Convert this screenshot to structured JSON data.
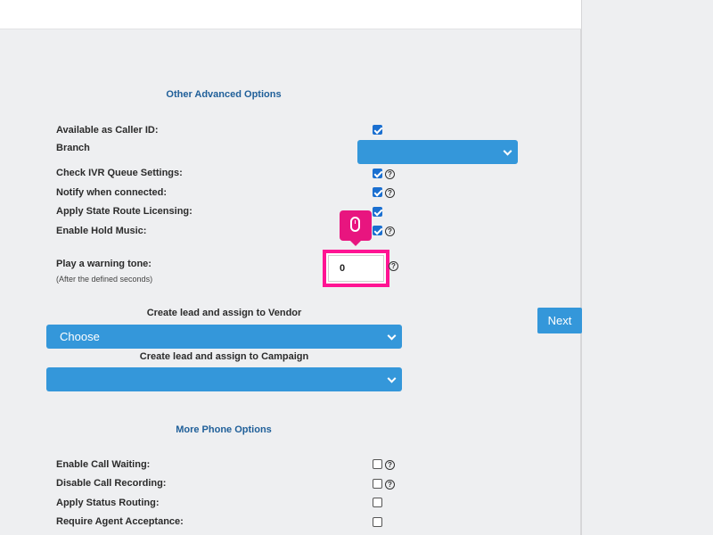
{
  "sections": {
    "other_advanced": "Other Advanced Options",
    "more_phone": "More Phone Options"
  },
  "advanced_rows": {
    "caller_id": {
      "label": "Available as Caller ID:",
      "checked": true,
      "help": false
    },
    "branch": {
      "label": "Branch",
      "value": ""
    },
    "ivr_queue": {
      "label": "Check IVR Queue Settings:",
      "checked": true,
      "help": true
    },
    "notify_connected": {
      "label": "Notify when connected:",
      "checked": true,
      "help": true
    },
    "state_route": {
      "label": "Apply State Route Licensing:",
      "checked": true,
      "help": false
    },
    "hold_music": {
      "label": "Enable Hold Music:",
      "checked": true,
      "help": true
    }
  },
  "warning_tone": {
    "label": "Play a warning tone:",
    "sublabel": "(After the defined seconds)",
    "value": "0"
  },
  "vendor": {
    "label": "Create lead and assign to Vendor",
    "selected": "Choose"
  },
  "campaign": {
    "label": "Create lead and assign to Campaign",
    "selected": ""
  },
  "phone_rows": {
    "call_waiting": {
      "label": "Enable Call Waiting:",
      "checked": false,
      "help": true
    },
    "disable_recording": {
      "label": "Disable Call Recording:",
      "checked": false,
      "help": true
    },
    "status_routing": {
      "label": "Apply Status Routing:",
      "checked": false,
      "help": false
    },
    "agent_acceptance": {
      "label": "Require Agent Acceptance:",
      "checked": false,
      "help": false
    }
  },
  "next_button": "Next",
  "help_glyph": "?",
  "colors": {
    "accent": "#3497da",
    "section_title": "#1f5f99",
    "highlight": "#ff1493",
    "checkbox_checked": "#1a6fd0"
  }
}
